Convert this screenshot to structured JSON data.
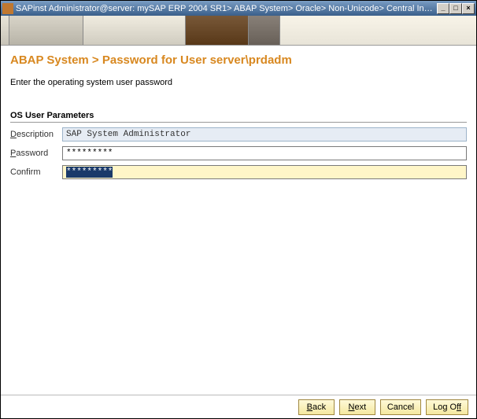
{
  "window": {
    "title": "SAPinst Administrator@server: mySAP ERP 2004 SR1> ABAP System> Oracle> Non-Unicode> Central Instance Instal..."
  },
  "page": {
    "breadcrumb": "ABAP System > Password for User server\\prdadm",
    "instruction": "Enter the operating system user password"
  },
  "section": {
    "header": "OS User Parameters",
    "description": {
      "label_prefix": "D",
      "label_rest": "escription",
      "value": "SAP System Administrator"
    },
    "password": {
      "label_prefix": "P",
      "label_rest": "assword",
      "mask": "*********"
    },
    "confirm": {
      "label": "Confirm",
      "mask": "*********"
    }
  },
  "buttons": {
    "back_prefix": "B",
    "back_rest": "ack",
    "next_prefix": "N",
    "next_rest": "ext",
    "cancel": "Cancel",
    "logoff": "Log O",
    "logoff_suffix": "ff"
  }
}
